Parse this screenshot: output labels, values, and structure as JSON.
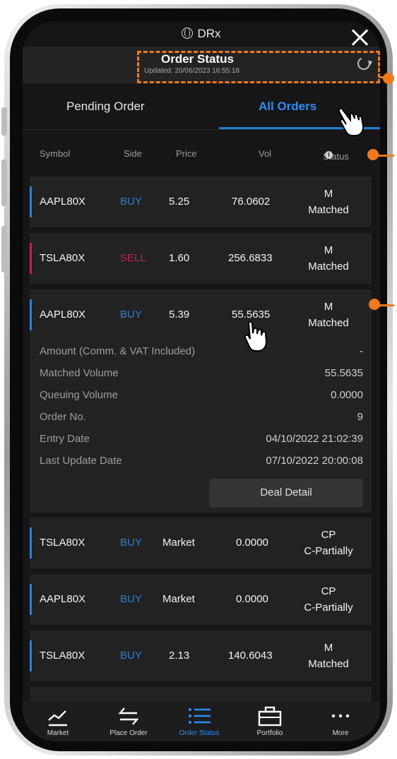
{
  "app": {
    "title": "DRx"
  },
  "header": {
    "title": "Order Status",
    "updated": "Updated: 20/06/2023 16:55:18"
  },
  "tabs": [
    {
      "label": "Pending Order"
    },
    {
      "label": "All Orders",
      "active": true
    }
  ],
  "columns": {
    "symbol": "Symbol",
    "side": "Side",
    "price": "Price",
    "vol": "Vol",
    "status": "Status"
  },
  "orders": [
    {
      "symbol": "AAPL80X",
      "side": "BUY",
      "price": "5.25",
      "vol": "76.0602",
      "status_code": "M",
      "status": "Matched"
    },
    {
      "symbol": "TSLA80X",
      "side": "SELL",
      "price": "1.60",
      "vol": "256.6833",
      "status_code": "M",
      "status": "Matched"
    },
    {
      "symbol": "AAPL80X",
      "side": "BUY",
      "price": "5.39",
      "vol": "55.5635",
      "status_code": "M",
      "status": "Matched"
    },
    {
      "symbol": "TSLA80X",
      "side": "BUY",
      "price": "Market",
      "vol": "0.0000",
      "status_code": "CP",
      "status": "C-Partially"
    },
    {
      "symbol": "AAPL80X",
      "side": "BUY",
      "price": "Market",
      "vol": "0.0000",
      "status_code": "CP",
      "status": "C-Partially"
    },
    {
      "symbol": "TSLA80X",
      "side": "BUY",
      "price": "2.13",
      "vol": "140.6043",
      "status_code": "M",
      "status": "Matched"
    }
  ],
  "detail": {
    "amount_label": "Amount (Comm. & VAT Included)",
    "amount_value": "-",
    "matched_label": "Matched Volume",
    "matched_value": "55.5635",
    "queuing_label": "Queuing Volume",
    "queuing_value": "0.0000",
    "order_no_label": "Order No.",
    "order_no_value": "9",
    "entry_label": "Entry Date",
    "entry_value": "04/10/2022 21:02:39",
    "update_label": "Last Update Date",
    "update_value": "07/10/2022 20:00:08",
    "deal_button": "Deal Detail"
  },
  "nav": [
    {
      "label": "Market",
      "icon": "chart-line-icon"
    },
    {
      "label": "Place Order",
      "icon": "swap-arrows-icon"
    },
    {
      "label": "Order Status",
      "icon": "list-icon",
      "active": true
    },
    {
      "label": "Portfolio",
      "icon": "briefcase-icon"
    },
    {
      "label": "More",
      "icon": "more-dots-icon"
    }
  ],
  "colors": {
    "accent": "#2d8ef5",
    "buy": "#2d7fd8",
    "sell": "#c2215a",
    "annotation": "#f0791e",
    "background": "#161616",
    "card": "#222222"
  }
}
